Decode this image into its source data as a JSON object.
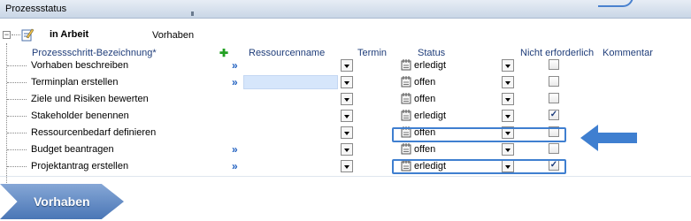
{
  "window": {
    "title": "Prozessstatus"
  },
  "group": {
    "status": "in Arbeit",
    "name": "Vorhaben",
    "collapse_symbol": "−"
  },
  "columns": {
    "step": "Prozessschritt-Bezeichnung*",
    "add": "✚",
    "resource": "Ressourcenname",
    "date": "Termin",
    "status": "Status",
    "not_required": "Nicht erforderlich",
    "comment": "Kommentar"
  },
  "rows": [
    {
      "name": "Vorhaben beschreiben",
      "link": "»",
      "status": "erledigt",
      "not_required": false
    },
    {
      "name": "Terminplan  erstellen",
      "link": "»",
      "status": "offen",
      "not_required": false
    },
    {
      "name": "Ziele und Risiken bewerten",
      "link": "",
      "status": "offen",
      "not_required": false
    },
    {
      "name": "Stakeholder benennen",
      "link": "",
      "status": "erledigt",
      "not_required": true
    },
    {
      "name": "Ressourcenbedarf definieren",
      "link": "",
      "status": "offen",
      "not_required": false
    },
    {
      "name": "Budget beantragen",
      "link": "»",
      "status": "offen",
      "not_required": false
    },
    {
      "name": "Projektantrag erstellen",
      "link": "»",
      "status": "erledigt",
      "not_required": true
    }
  ],
  "checkmark": "✓",
  "bottom_button": {
    "label": "Vorhaben"
  },
  "colors": {
    "accent": "#3f7fd0",
    "link": "#1f5fbf",
    "header_text": "#1f3d7a"
  }
}
